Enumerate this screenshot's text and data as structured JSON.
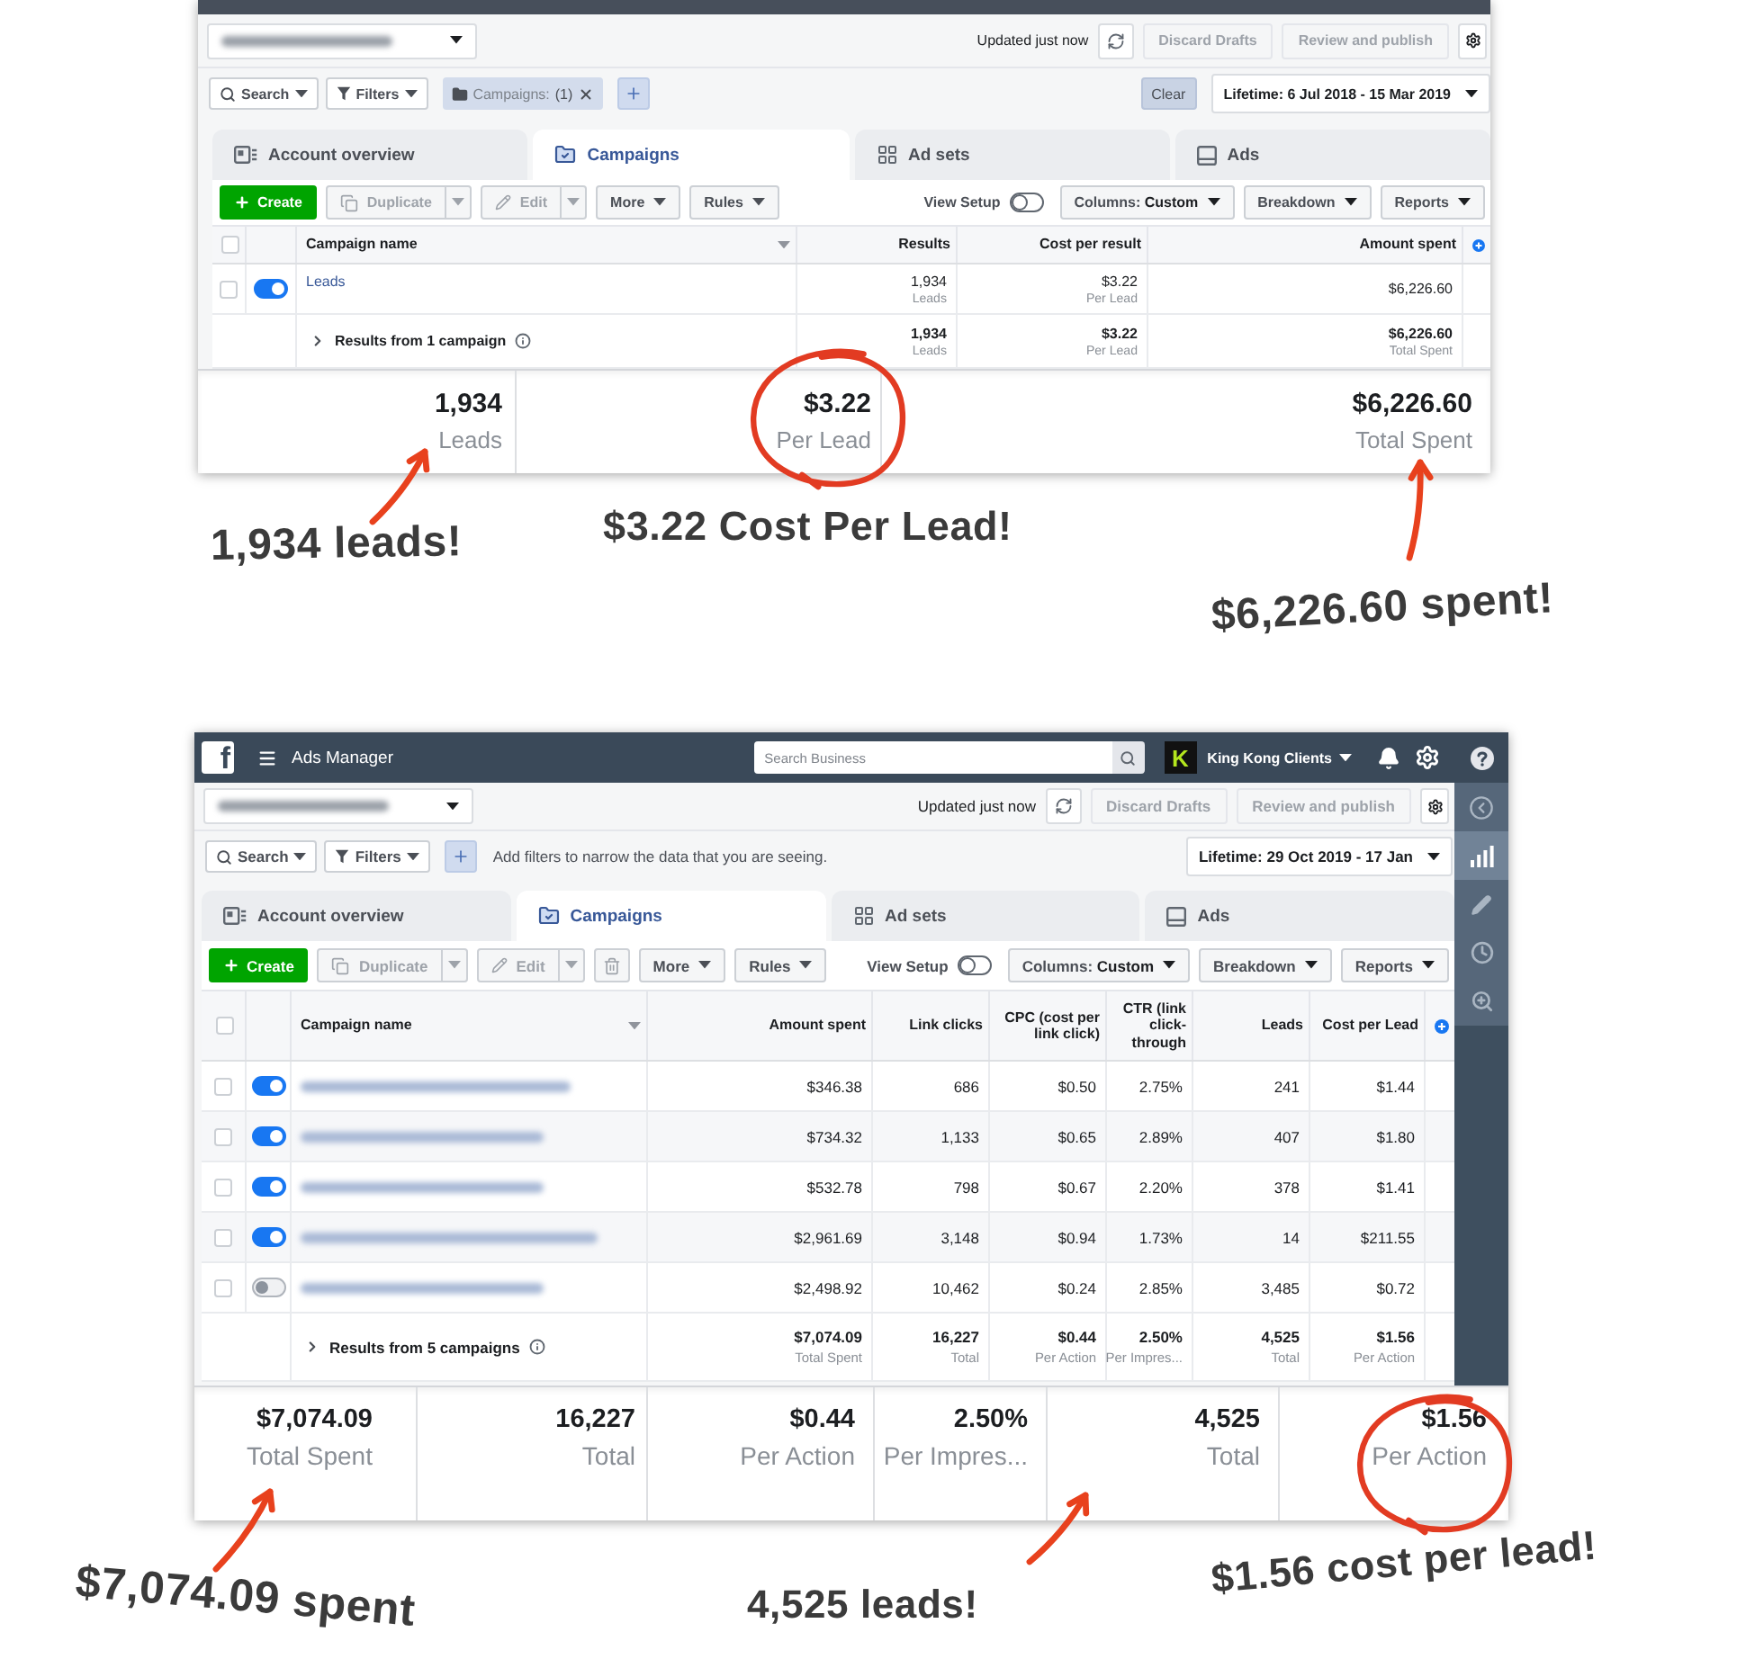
{
  "screenshots": [
    {
      "status": {
        "updated": "Updated just now",
        "buttons": [
          {
            "label": "Discard Drafts",
            "disabled": true
          },
          {
            "label": "Review and publish",
            "disabled": true
          }
        ]
      },
      "filters": {
        "buttons": [
          {
            "label": "Search",
            "kind": "search"
          },
          {
            "label": "Filters",
            "kind": "filter"
          }
        ],
        "chips": [
          {
            "label": "Campaigns:",
            "count": "(1)"
          }
        ],
        "clear": "Clear",
        "date_range": "Lifetime: 6 Jul 2018 - 15 Mar 2019"
      },
      "tabs": [
        {
          "label": "Account overview",
          "kind": "overview",
          "selected": false
        },
        {
          "label": "Campaigns",
          "kind": "campaigns",
          "selected": true
        },
        {
          "label": "Ad sets",
          "kind": "adsets",
          "selected": false
        },
        {
          "label": "Ads",
          "kind": "ads",
          "selected": false
        }
      ],
      "toolbar": {
        "actions": [
          {
            "label": "Create",
            "kind": "create",
            "disabled": false
          },
          {
            "label": "Duplicate",
            "kind": "duplicate",
            "disabled": true
          },
          {
            "label": "Edit",
            "kind": "edit",
            "disabled": true
          },
          {
            "label": "More",
            "kind": "menu",
            "disabled": false
          },
          {
            "label": "Rules",
            "kind": "menu",
            "disabled": false
          }
        ],
        "view_setup": {
          "label": "View Setup",
          "on": false
        },
        "menus": [
          {
            "label": "Columns:",
            "value": "Custom"
          },
          {
            "label": "Breakdown"
          },
          {
            "label": "Reports"
          }
        ]
      },
      "table": {
        "select_all_checked": false,
        "name_column": "Campaign name",
        "columns": [
          "Results",
          "Cost per result",
          "Amount spent"
        ],
        "rows": [
          {
            "checked": false,
            "on": true,
            "name": "Leads",
            "cells": [
              {
                "value": "1,934",
                "sub": "Leads"
              },
              {
                "value": "$3.22",
                "sub": "Per Lead"
              },
              {
                "value": "$6,226.60"
              }
            ]
          }
        ],
        "totals": {
          "label": "Results from 1 campaign",
          "cells": [
            {
              "value": "1,934",
              "sub": "Leads"
            },
            {
              "value": "$3.22",
              "sub": "Per Lead"
            },
            {
              "value": "$6,226.60",
              "sub": "Total Spent"
            }
          ]
        }
      },
      "summary": [
        {
          "value": "1,934",
          "label": "Leads",
          "circled": false
        },
        {
          "value": "$3.22",
          "label": "Per Lead",
          "circled": true
        },
        {
          "value": "$6,226.60",
          "label": "Total Spent",
          "circled": false
        }
      ],
      "notes": [
        {
          "text": "1,934 leads!",
          "arrow": true
        },
        {
          "text": "$3.22 Cost Per Lead!",
          "arrow": false
        },
        {
          "text": "$6,226.60 spent!",
          "arrow": true
        }
      ]
    },
    {
      "header": {
        "logo": "f",
        "title": "Ads Manager",
        "search_placeholder": "Search Business",
        "account_initial": "K",
        "account_name": "King Kong Clients"
      },
      "status": {
        "updated": "Updated just now",
        "buttons": [
          {
            "label": "Discard Drafts",
            "disabled": true
          },
          {
            "label": "Review and publish",
            "disabled": true
          }
        ]
      },
      "filters": {
        "buttons": [
          {
            "label": "Search",
            "kind": "search"
          },
          {
            "label": "Filters",
            "kind": "filter"
          }
        ],
        "hint": "Add filters to narrow the data that you are seeing.",
        "date_range": "Lifetime: 29 Oct 2019 - 17 Jan"
      },
      "tabs": [
        {
          "label": "Account overview",
          "kind": "overview",
          "selected": false
        },
        {
          "label": "Campaigns",
          "kind": "campaigns",
          "selected": true
        },
        {
          "label": "Ad sets",
          "kind": "adsets",
          "selected": false
        },
        {
          "label": "Ads",
          "kind": "ads",
          "selected": false
        }
      ],
      "toolbar": {
        "actions": [
          {
            "label": "Create",
            "kind": "create",
            "disabled": false
          },
          {
            "label": "Duplicate",
            "kind": "duplicate",
            "disabled": true
          },
          {
            "label": "Edit",
            "kind": "edit",
            "disabled": true
          },
          {
            "kind": "delete",
            "disabled": true
          },
          {
            "label": "More",
            "kind": "menu",
            "disabled": false
          },
          {
            "label": "Rules",
            "kind": "menu",
            "disabled": false
          }
        ],
        "view_setup": {
          "label": "View Setup",
          "on": false
        },
        "menus": [
          {
            "label": "Columns:",
            "value": "Custom"
          },
          {
            "label": "Breakdown"
          },
          {
            "label": "Reports"
          }
        ]
      },
      "table": {
        "select_all_checked": false,
        "name_column": "Campaign name",
        "columns": [
          "Amount spent",
          "Link clicks",
          "CPC (cost per link click)",
          "CTR (link click-through",
          "Leads",
          "Cost per Lead"
        ],
        "rows": [
          {
            "checked": false,
            "on": true,
            "cells": [
              {
                "value": "$346.38"
              },
              {
                "value": "686"
              },
              {
                "value": "$0.50"
              },
              {
                "value": "2.75%"
              },
              {
                "value": "241"
              },
              {
                "value": "$1.44"
              }
            ]
          },
          {
            "checked": false,
            "on": true,
            "cells": [
              {
                "value": "$734.32"
              },
              {
                "value": "1,133"
              },
              {
                "value": "$0.65"
              },
              {
                "value": "2.89%"
              },
              {
                "value": "407"
              },
              {
                "value": "$1.80"
              }
            ]
          },
          {
            "checked": false,
            "on": true,
            "cells": [
              {
                "value": "$532.78"
              },
              {
                "value": "798"
              },
              {
                "value": "$0.67"
              },
              {
                "value": "2.20%"
              },
              {
                "value": "378"
              },
              {
                "value": "$1.41"
              }
            ]
          },
          {
            "checked": false,
            "on": true,
            "cells": [
              {
                "value": "$2,961.69"
              },
              {
                "value": "3,148"
              },
              {
                "value": "$0.94"
              },
              {
                "value": "1.73%"
              },
              {
                "value": "14"
              },
              {
                "value": "$211.55"
              }
            ]
          },
          {
            "checked": false,
            "on": false,
            "cells": [
              {
                "value": "$2,498.92"
              },
              {
                "value": "10,462"
              },
              {
                "value": "$0.24"
              },
              {
                "value": "2.85%"
              },
              {
                "value": "3,485"
              },
              {
                "value": "$0.72"
              }
            ]
          }
        ],
        "totals": {
          "label": "Results from 5 campaigns",
          "cells": [
            {
              "value": "$7,074.09",
              "sub": "Total Spent"
            },
            {
              "value": "16,227",
              "sub": "Total"
            },
            {
              "value": "$0.44",
              "sub": "Per Action"
            },
            {
              "value": "2.50%",
              "sub": "Per Impres..."
            },
            {
              "value": "4,525",
              "sub": "Total"
            },
            {
              "value": "$1.56",
              "sub": "Per Action"
            }
          ]
        }
      },
      "sidebar": [
        {
          "kind": "back",
          "selected": false
        },
        {
          "kind": "chart",
          "selected": true
        },
        {
          "kind": "edit",
          "selected": false
        },
        {
          "kind": "history",
          "selected": false
        },
        {
          "kind": "inspect",
          "selected": false
        }
      ],
      "summary": [
        {
          "value": "$7,074.09",
          "label": "Total Spent",
          "circled": false
        },
        {
          "value": "16,227",
          "label": "Total",
          "circled": false
        },
        {
          "value": "$0.44",
          "label": "Per Action",
          "circled": false
        },
        {
          "value": "2.50%",
          "label": "Per Impres...",
          "circled": false
        },
        {
          "value": "4,525",
          "label": "Total",
          "circled": false
        },
        {
          "value": "$1.56",
          "label": "Per Action",
          "circled": true
        }
      ],
      "notes": [
        {
          "text": "$7,074.09 spent",
          "arrow": true
        },
        {
          "text": "4,525 leads!",
          "arrow": true
        },
        {
          "text": "$1.56 cost per lead!",
          "arrow": false
        }
      ]
    }
  ]
}
